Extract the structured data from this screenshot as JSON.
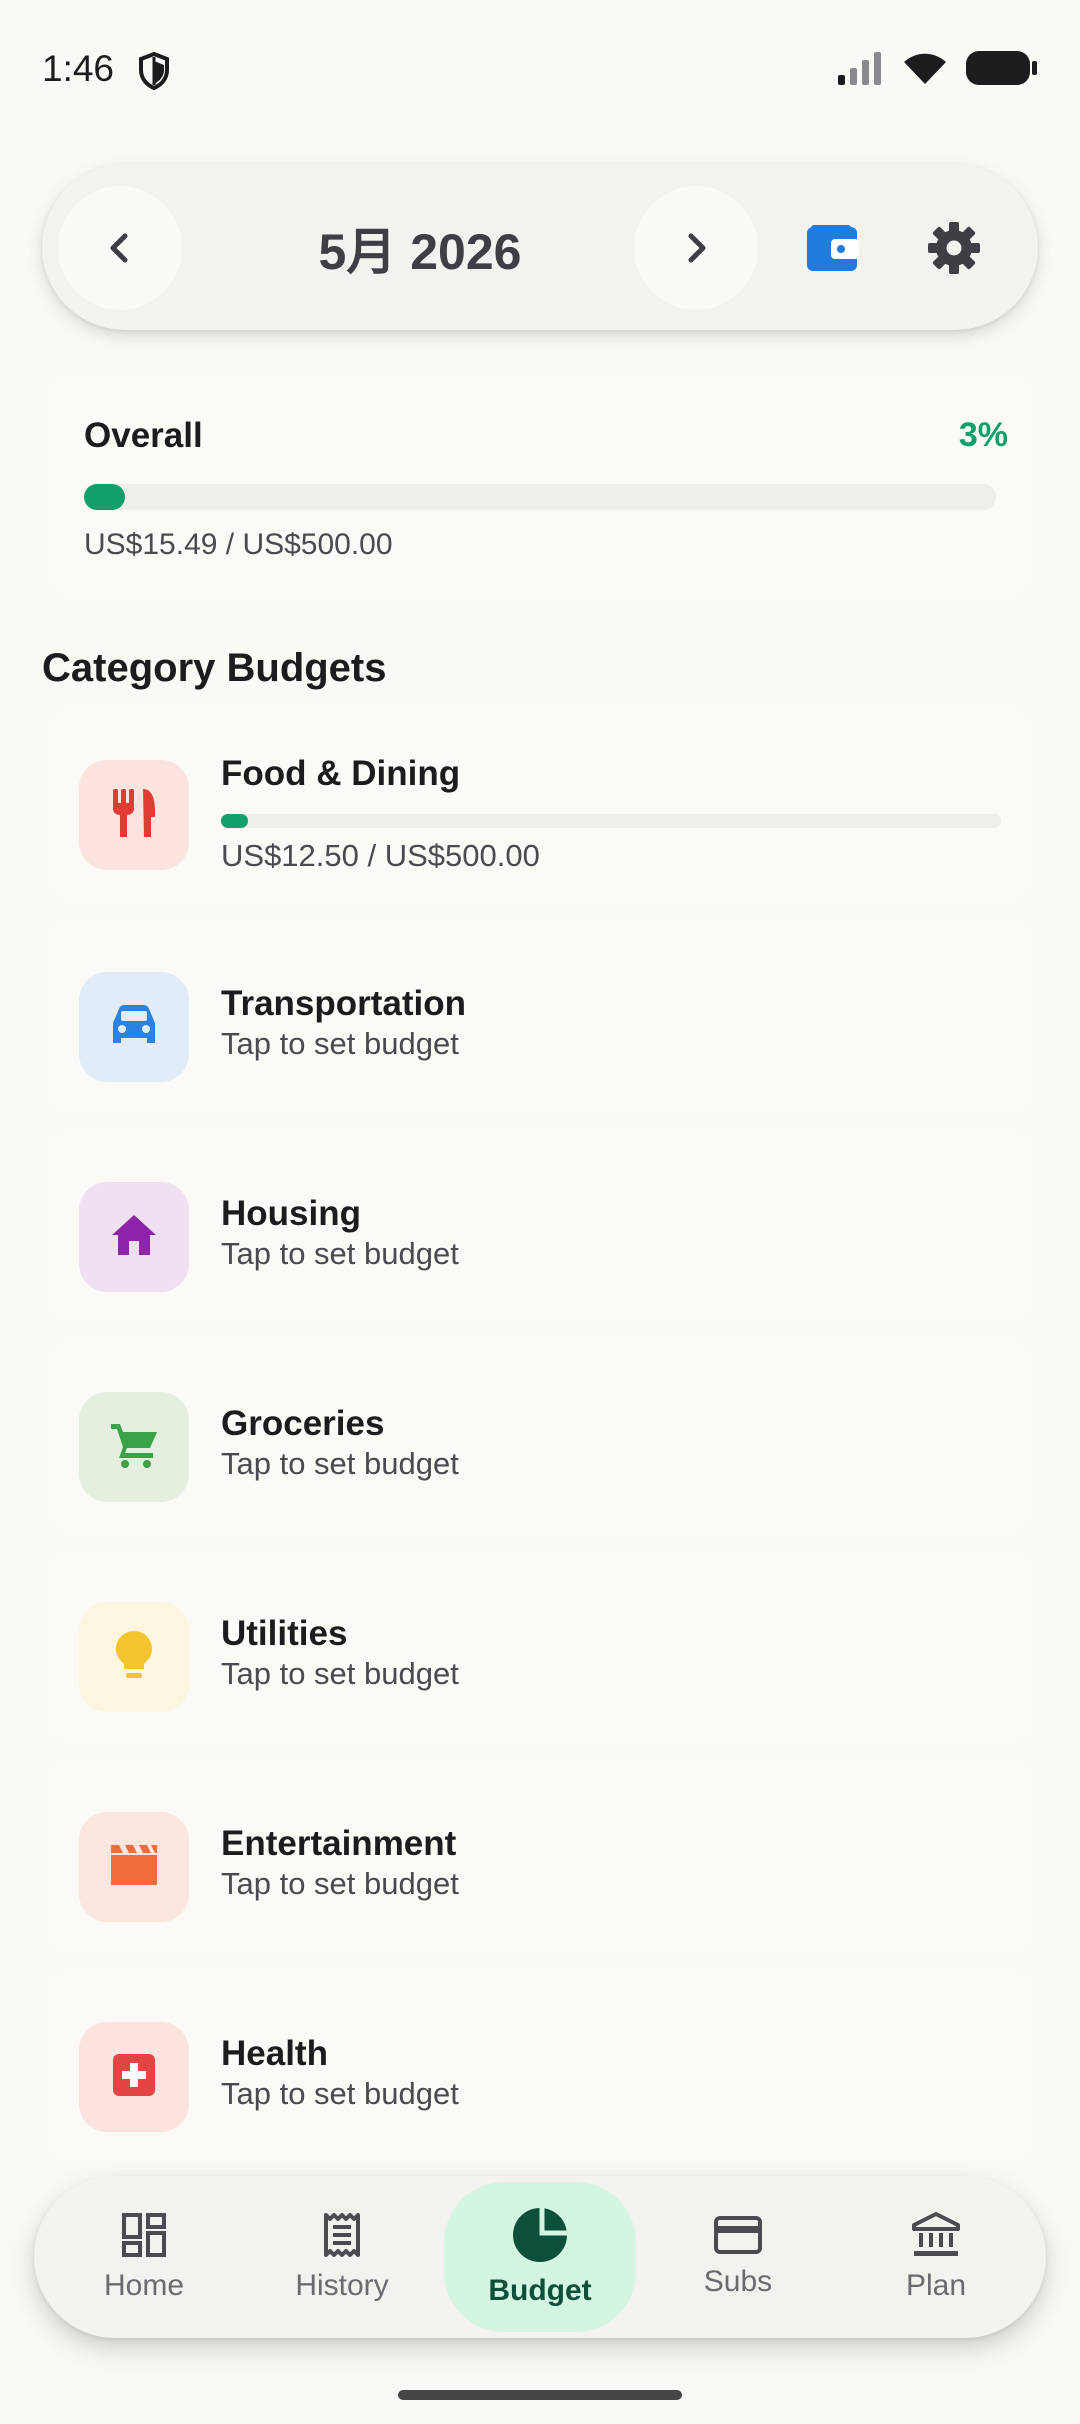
{
  "status_bar": {
    "time": "1:46"
  },
  "header": {
    "month_title": "5月 2026"
  },
  "overall": {
    "label": "Overall",
    "percent_text": "3%",
    "progress_fraction": 0.03,
    "amount_text": "US$15.49 / US$500.00",
    "accent_color": "#12a06a"
  },
  "section_title": "Category Budgets",
  "categories": [
    {
      "name": "Food & Dining",
      "icon": "fork-knife-icon",
      "icon_color": "#e23b33",
      "icon_bg": "#fbe3df",
      "amount_text": "US$12.50 / US$500.00",
      "progress_fraction": 0.025,
      "has_budget": true
    },
    {
      "name": "Transportation",
      "icon": "car-icon",
      "icon_color": "#2b82e0",
      "icon_bg": "#e1ecf7",
      "subtitle": "Tap to set budget",
      "has_budget": false
    },
    {
      "name": "Housing",
      "icon": "house-icon",
      "icon_color": "#8e24aa",
      "icon_bg": "#efe1f2",
      "subtitle": "Tap to set budget",
      "has_budget": false
    },
    {
      "name": "Groceries",
      "icon": "cart-icon",
      "icon_color": "#3aa348",
      "icon_bg": "#e4efe0",
      "subtitle": "Tap to set budget",
      "has_budget": false
    },
    {
      "name": "Utilities",
      "icon": "lightbulb-icon",
      "icon_color": "#f4c430",
      "icon_bg": "#fcf6df",
      "subtitle": "Tap to set budget",
      "has_budget": false
    },
    {
      "name": "Entertainment",
      "icon": "clapperboard-icon",
      "icon_color": "#f06d3a",
      "icon_bg": "#fbe7df",
      "subtitle": "Tap to set budget",
      "has_budget": false
    },
    {
      "name": "Health",
      "icon": "medical-cross-icon",
      "icon_color": "#e34543",
      "icon_bg": "#fbe3df",
      "subtitle": "Tap to set budget",
      "has_budget": false
    }
  ],
  "bottom_nav": {
    "items": [
      {
        "label": "Home",
        "icon": "dashboard-icon"
      },
      {
        "label": "History",
        "icon": "receipt-icon"
      },
      {
        "label": "Budget",
        "icon": "pie-chart-icon",
        "active": true
      },
      {
        "label": "Subs",
        "icon": "credit-card-icon"
      },
      {
        "label": "Plan",
        "icon": "bank-icon"
      }
    ],
    "active_color": "#0c4f3b",
    "active_bg": "#d4f5e2"
  }
}
